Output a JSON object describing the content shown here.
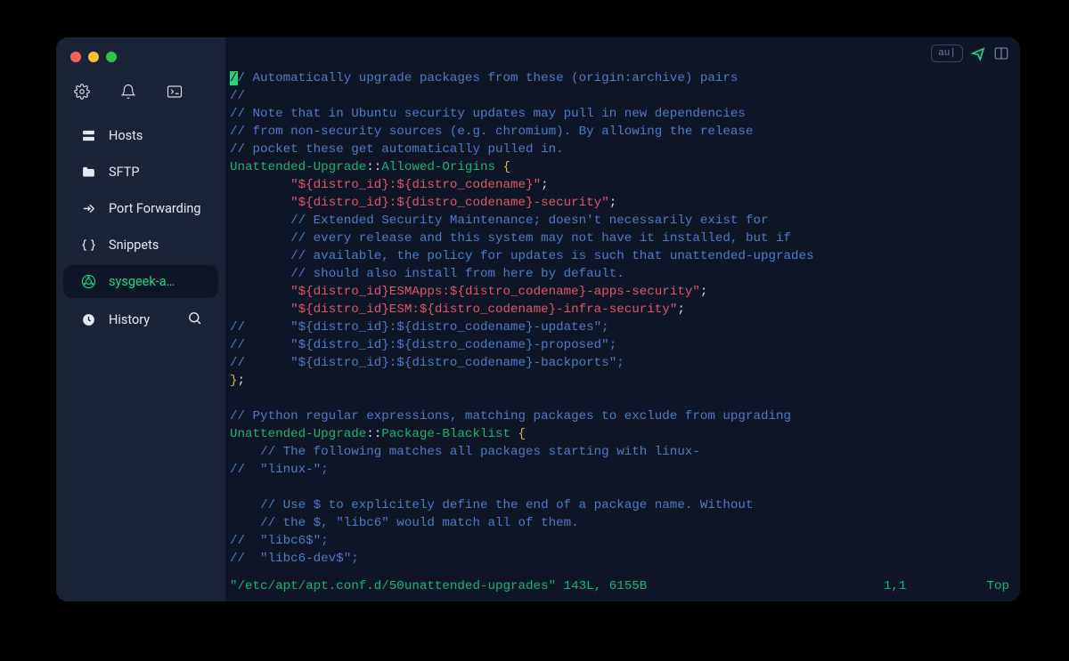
{
  "sidebar": {
    "items": [
      {
        "label": "Hosts"
      },
      {
        "label": "SFTP"
      },
      {
        "label": "Port Forwarding"
      },
      {
        "label": "Snippets"
      },
      {
        "label": "sysgeek-a…"
      },
      {
        "label": "History"
      }
    ]
  },
  "header": {
    "badge": "au|"
  },
  "code_lines": [
    [
      {
        "t": "cur",
        "v": "/"
      },
      {
        "t": "cmt",
        "v": "/ Automatically upgrade packages from these (origin:archive) pairs"
      }
    ],
    [
      {
        "t": "cmt",
        "v": "//"
      }
    ],
    [
      {
        "t": "cmt",
        "v": "// Note that in Ubuntu security updates may pull in new dependencies"
      }
    ],
    [
      {
        "t": "cmt",
        "v": "// from non-security sources (e.g. chromium). By allowing the release"
      }
    ],
    [
      {
        "t": "cmt",
        "v": "// pocket these get automatically pulled in."
      }
    ],
    [
      {
        "t": "key",
        "v": "Unattended-Upgrade"
      },
      {
        "t": "op",
        "v": "::"
      },
      {
        "t": "key",
        "v": "Allowed-Origins"
      },
      {
        "t": "op",
        "v": " "
      },
      {
        "t": "pun",
        "v": "{"
      }
    ],
    [
      {
        "t": "op",
        "v": "        "
      },
      {
        "t": "str",
        "v": "\"${distro_id}:${distro_codename}\""
      },
      {
        "t": "op",
        "v": ";"
      }
    ],
    [
      {
        "t": "op",
        "v": "        "
      },
      {
        "t": "str",
        "v": "\"${distro_id}:${distro_codename}-security\""
      },
      {
        "t": "op",
        "v": ";"
      }
    ],
    [
      {
        "t": "op",
        "v": "        "
      },
      {
        "t": "cmt",
        "v": "// Extended Security Maintenance; doesn't necessarily exist for"
      }
    ],
    [
      {
        "t": "op",
        "v": "        "
      },
      {
        "t": "cmt",
        "v": "// every release and this system may not have it installed, but if"
      }
    ],
    [
      {
        "t": "op",
        "v": "        "
      },
      {
        "t": "cmt",
        "v": "// available, the policy for updates is such that unattended-upgrades"
      }
    ],
    [
      {
        "t": "op",
        "v": "        "
      },
      {
        "t": "cmt",
        "v": "// should also install from here by default."
      }
    ],
    [
      {
        "t": "op",
        "v": "        "
      },
      {
        "t": "str",
        "v": "\"${distro_id}ESMApps:${distro_codename}-apps-security\""
      },
      {
        "t": "op",
        "v": ";"
      }
    ],
    [
      {
        "t": "op",
        "v": "        "
      },
      {
        "t": "str",
        "v": "\"${distro_id}ESM:${distro_codename}-infra-security\""
      },
      {
        "t": "op",
        "v": ";"
      }
    ],
    [
      {
        "t": "cmt",
        "v": "//      \"${distro_id}:${distro_codename}-updates\";"
      }
    ],
    [
      {
        "t": "cmt",
        "v": "//      \"${distro_id}:${distro_codename}-proposed\";"
      }
    ],
    [
      {
        "t": "cmt",
        "v": "//      \"${distro_id}:${distro_codename}-backports\";"
      }
    ],
    [
      {
        "t": "pun",
        "v": "}"
      },
      {
        "t": "op",
        "v": ";"
      }
    ],
    [
      {
        "t": "op",
        "v": " "
      }
    ],
    [
      {
        "t": "cmt",
        "v": "// Python regular expressions, matching packages to exclude from upgrading"
      }
    ],
    [
      {
        "t": "key",
        "v": "Unattended-Upgrade"
      },
      {
        "t": "op",
        "v": "::"
      },
      {
        "t": "key",
        "v": "Package-Blacklist"
      },
      {
        "t": "op",
        "v": " "
      },
      {
        "t": "pun",
        "v": "{"
      }
    ],
    [
      {
        "t": "op",
        "v": "    "
      },
      {
        "t": "cmt",
        "v": "// The following matches all packages starting with linux-"
      }
    ],
    [
      {
        "t": "cmt",
        "v": "//  \"linux-\";"
      }
    ],
    [
      {
        "t": "op",
        "v": " "
      }
    ],
    [
      {
        "t": "op",
        "v": "    "
      },
      {
        "t": "cmt",
        "v": "// Use $ to explicitely define the end of a package name. Without"
      }
    ],
    [
      {
        "t": "op",
        "v": "    "
      },
      {
        "t": "cmt",
        "v": "// the $, \"libc6\" would match all of them."
      }
    ],
    [
      {
        "t": "cmt",
        "v": "//  \"libc6$\";"
      }
    ],
    [
      {
        "t": "cmt",
        "v": "//  \"libc6-dev$\";"
      }
    ]
  ],
  "status": {
    "filename": "\"/etc/apt/apt.conf.d/50unattended-upgrades\" 143L, 6155B",
    "position": "1,1",
    "scroll": "Top"
  },
  "colors": {
    "bg": "#0e1628",
    "sidebar": "#1b2436",
    "green": "#18b66b",
    "comment": "#4f79c9",
    "string": "#e25563",
    "punct": "#d9b24a"
  }
}
